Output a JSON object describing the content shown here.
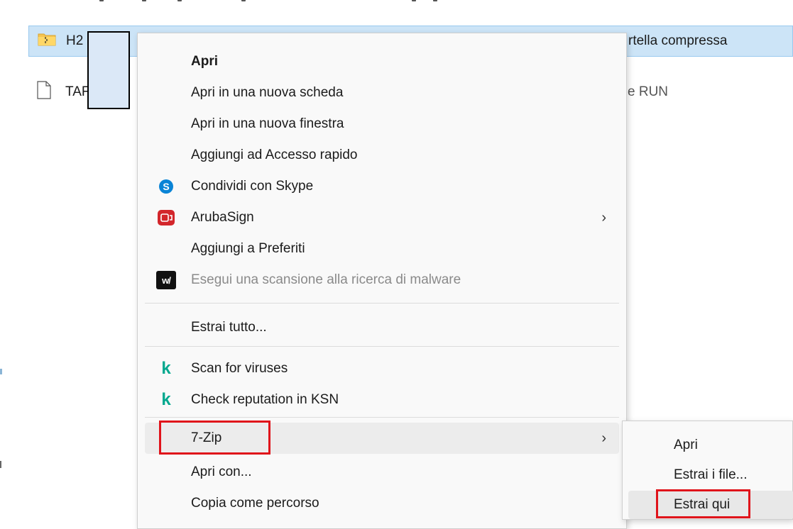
{
  "files": [
    {
      "name_visible": "H2",
      "type_label": "rtella compressa",
      "icon": "zip-folder-icon",
      "selected": true
    },
    {
      "name_visible": "TAF",
      "type_label": "e RUN",
      "icon": "file-icon",
      "selected": false
    }
  ],
  "context_menu": {
    "items": [
      {
        "label": "Apri",
        "bold": true
      },
      {
        "label": "Apri in una nuova scheda"
      },
      {
        "label": "Apri in una nuova finestra"
      },
      {
        "label": "Aggiungi ad Accesso rapido"
      },
      {
        "label": "Condividi con Skype",
        "icon": "skype-icon"
      },
      {
        "label": "ArubaSign",
        "icon": "arubasign-icon",
        "submenu_arrow": "›"
      },
      {
        "label": "Aggiungi a Preferiti"
      },
      {
        "label": "Esegui una scansione alla ricerca di malware",
        "icon": "malwarebytes-icon",
        "disabled": true
      },
      {
        "label": "Estrai tutto..."
      },
      {
        "label": "Scan for viruses",
        "icon": "kaspersky-icon"
      },
      {
        "label": "Check reputation in KSN",
        "icon": "kaspersky-icon"
      },
      {
        "label": "7-Zip",
        "submenu_arrow": "›",
        "highlighted": true
      },
      {
        "label": "Apri con..."
      },
      {
        "label": "Copia come percorso"
      }
    ]
  },
  "submenu_7zip": {
    "items": [
      {
        "label": "Apri"
      },
      {
        "label": "Estrai i file..."
      },
      {
        "label": "Estrai qui",
        "highlighted": true
      }
    ]
  },
  "icon_glyphs": {
    "skype": "S",
    "kaspersky": "k",
    "malwarebytes": "w/"
  },
  "colors": {
    "selection_bg": "#cce4f7",
    "highlight_box": "#e0141b",
    "skype": "#0a84d6",
    "arubasign": "#d3262b",
    "kaspersky": "#00a88e"
  }
}
